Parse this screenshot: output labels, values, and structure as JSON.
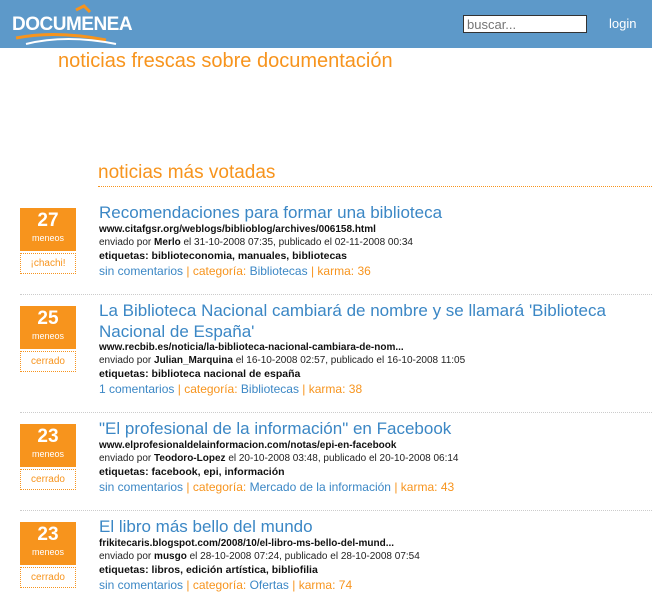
{
  "header": {
    "logo_text": "DOCUMENEA",
    "search_placeholder": "buscar...",
    "login_label": "login"
  },
  "tagline": "noticias frescas sobre documentación",
  "section_title": "noticias más votadas",
  "colors": {
    "brand_orange": "#f7941d",
    "header_blue": "#5d99c9",
    "link_blue": "#3b87c5"
  },
  "labels": {
    "meneos": "meneos",
    "enviado_por": "enviado por",
    "etiquetas": "etiquetas",
    "categoria": "categoría:",
    "karma": "karma:",
    "sep": "|"
  },
  "news": [
    {
      "votes": "27",
      "action": "¡chachi!",
      "title": "Recomendaciones para formar una biblioteca",
      "url": "www.citafgsr.org/weblogs/biblioblog/archives/006158.html",
      "author": "Merlo",
      "dates": "el 31-10-2008 07:35, publicado el 02-11-2008 00:34",
      "tags": "biblioteconomia, manuales, bibliotecas",
      "comments": "sin comentarios",
      "category": "Bibliotecas",
      "karma": "36"
    },
    {
      "votes": "25",
      "action": "cerrado",
      "title": "La Biblioteca Nacional cambiará de nombre y se llamará 'Biblioteca Nacional de España'",
      "url": "www.recbib.es/noticia/la-biblioteca-nacional-cambiara-de-nom...",
      "author": "Julian_Marquina",
      "dates": "el 16-10-2008 02:57, publicado el 16-10-2008 11:05",
      "tags": "biblioteca nacional de españa",
      "comments": "1 comentarios",
      "category": "Bibliotecas",
      "karma": "38"
    },
    {
      "votes": "23",
      "action": "cerrado",
      "title": "\"El profesional de la información\" en Facebook",
      "url": "www.elprofesionaldelainformacion.com/notas/epi-en-facebook",
      "author": "Teodoro-Lopez",
      "dates": "el 20-10-2008 03:48, publicado el 20-10-2008 06:14",
      "tags": "facebook, epi, información",
      "comments": "sin comentarios",
      "category": "Mercado de la información",
      "karma": "43"
    },
    {
      "votes": "23",
      "action": "cerrado",
      "title": "El libro más bello del mundo",
      "url": "frikitecaris.blogspot.com/2008/10/el-libro-ms-bello-del-mund...",
      "author": "musgo",
      "dates": "el 28-10-2008 07:24, publicado el 28-10-2008 07:54",
      "tags": "libros, edición artística, bibliofilia",
      "comments": "sin comentarios",
      "category": "Ofertas",
      "karma": "74"
    }
  ]
}
